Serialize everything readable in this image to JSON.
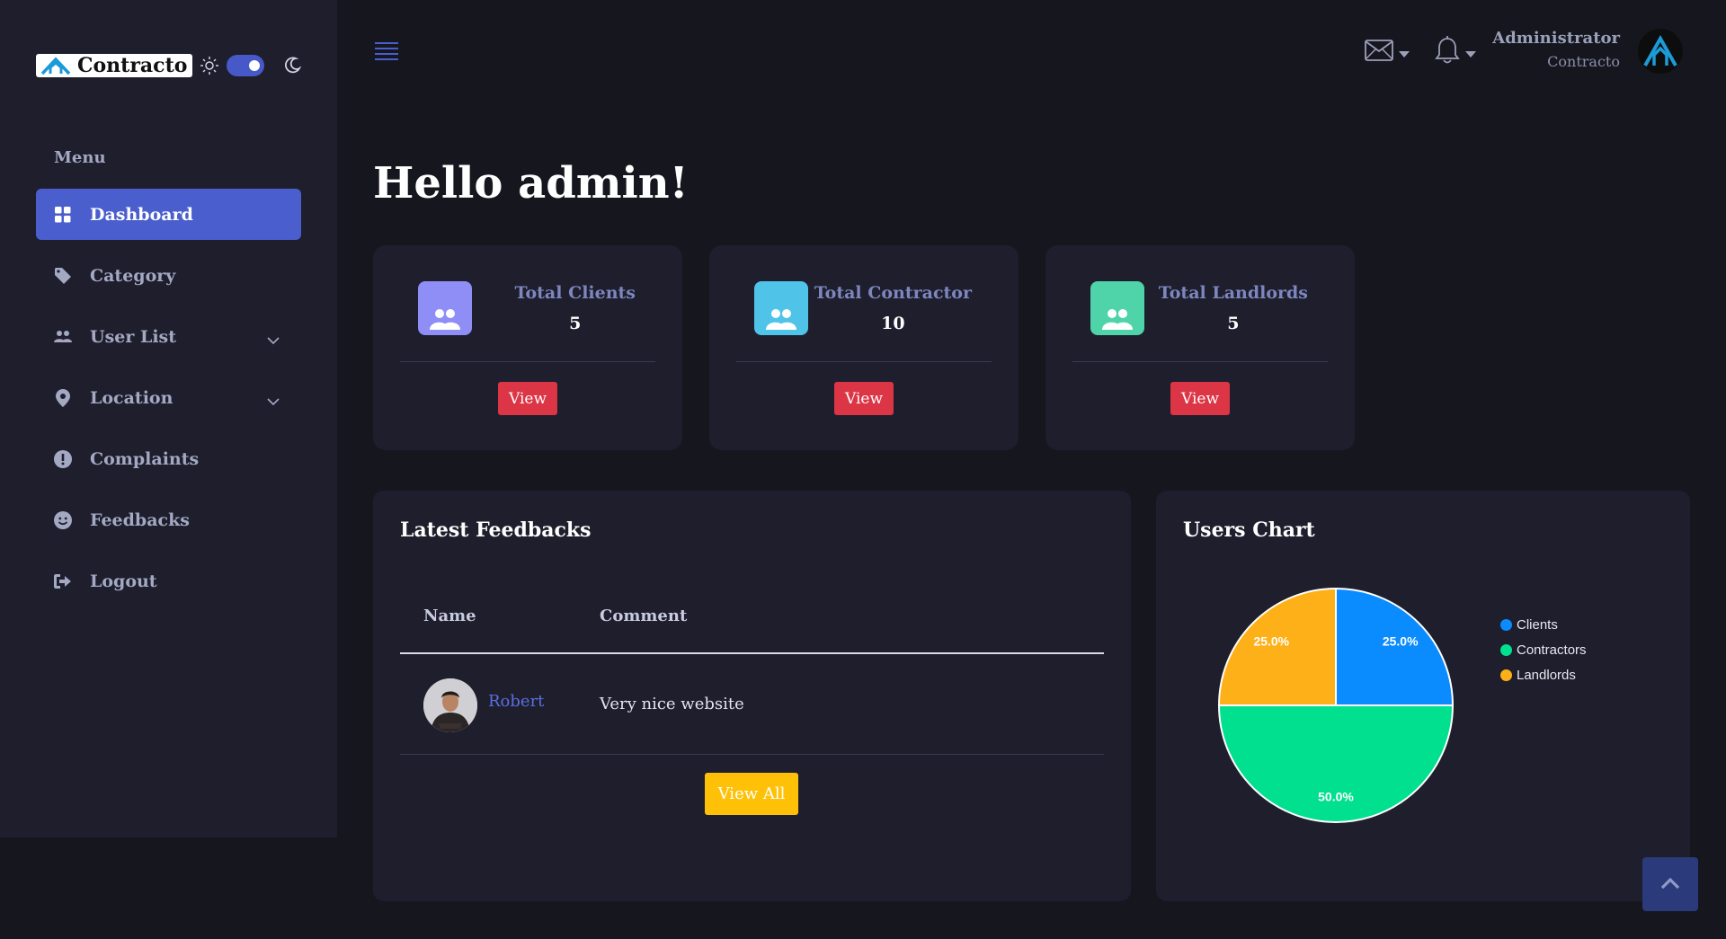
{
  "brand": {
    "name": "Contracto"
  },
  "sidebar": {
    "heading": "Menu",
    "items": [
      {
        "label": "Dashboard",
        "icon": "grid-icon"
      },
      {
        "label": "Category",
        "icon": "tag-icon"
      },
      {
        "label": "User List",
        "icon": "users-icon"
      },
      {
        "label": "Location",
        "icon": "map-pin-icon"
      },
      {
        "label": "Complaints",
        "icon": "exclamation-icon"
      },
      {
        "label": "Feedbacks",
        "icon": "smile-icon"
      },
      {
        "label": "Logout",
        "icon": "logout-icon"
      }
    ]
  },
  "header": {
    "user_name": "Administrator",
    "user_role": "Contracto"
  },
  "main": {
    "greeting": "Hello admin!",
    "stats": [
      {
        "label": "Total Clients",
        "value": "5",
        "button": "View",
        "color": "#8f8ef7"
      },
      {
        "label": "Total Contractor",
        "value": "10",
        "button": "View",
        "color": "#4fc3e8"
      },
      {
        "label": "Total Landlords",
        "value": "5",
        "button": "View",
        "color": "#4fd3a8"
      }
    ]
  },
  "feedbacks": {
    "title": "Latest Feedbacks",
    "columns": [
      "Name",
      "Comment"
    ],
    "rows": [
      {
        "name": "Robert",
        "comment": "Very nice website"
      }
    ],
    "view_all": "View All"
  },
  "users_chart": {
    "title": "Users Chart"
  },
  "chart_data": {
    "type": "pie",
    "categories": [
      "Clients",
      "Contractors",
      "Landlords"
    ],
    "values": [
      25.0,
      50.0,
      25.0
    ],
    "labels": [
      "25.0%",
      "50.0%",
      "25.0%"
    ],
    "colors": [
      "#0a8cff",
      "#00e08e",
      "#feb019"
    ],
    "legend": "right"
  }
}
